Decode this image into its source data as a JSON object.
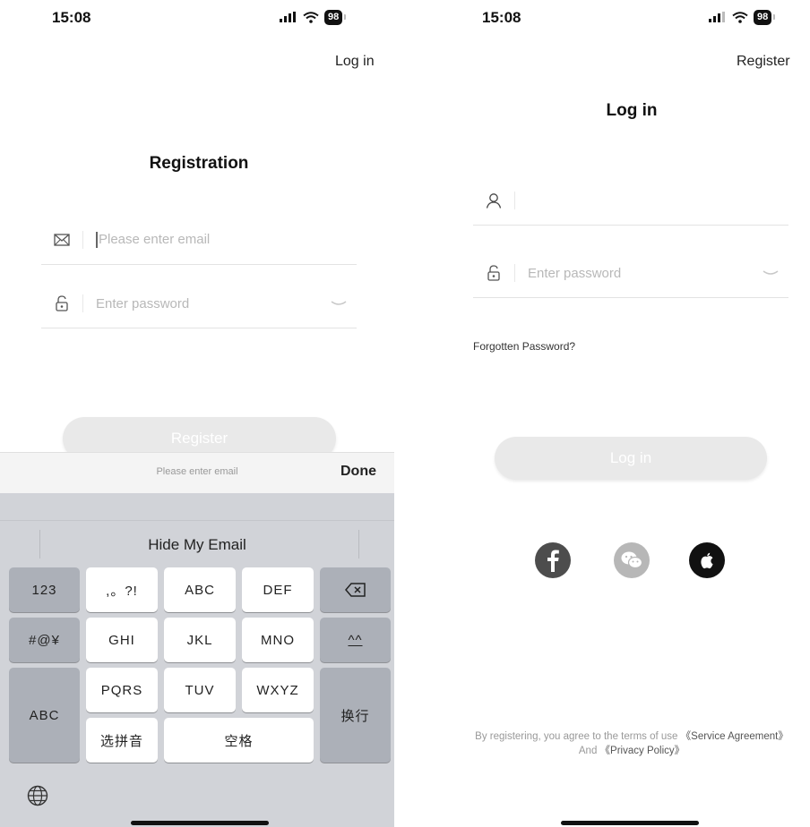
{
  "status_bar": {
    "time": "15:08",
    "battery": "98"
  },
  "registration": {
    "nav_link": "Log in",
    "title": "Registration",
    "email_placeholder": "Please enter email",
    "password_placeholder": "Enter password",
    "button": "Register"
  },
  "keyboard": {
    "accessory_hint": "Please enter email",
    "done": "Done",
    "suggestion": "Hide My Email",
    "keys": {
      "k123": "123",
      "punct": ",。?!",
      "abc_key": "ABC",
      "def": "DEF",
      "symbols": "#@¥",
      "ghi": "GHI",
      "jkl": "JKL",
      "mno": "MNO",
      "emoji": "^^",
      "abc_left": "ABC",
      "pqrs": "PQRS",
      "tuv": "TUV",
      "wxyz": "WXYZ",
      "pinyin": "选拼音",
      "space": "空格",
      "return": "换行"
    }
  },
  "login": {
    "nav_link": "Register",
    "title": "Log in",
    "password_placeholder": "Enter password",
    "forgot": "Forgotten Password?",
    "button": "Log in",
    "social": [
      "facebook-icon",
      "wechat-icon",
      "apple-icon"
    ],
    "terms_prefix": "By registering, you agree to the terms of use",
    "terms_service": "《Service Agreement》",
    "terms_and": "And",
    "terms_privacy": "《Privacy Policy》"
  },
  "colors": {
    "button_disabled": "#e9e9e9",
    "keyboard_bg": "#d1d3d8",
    "key_dark": "#acb0b8"
  }
}
